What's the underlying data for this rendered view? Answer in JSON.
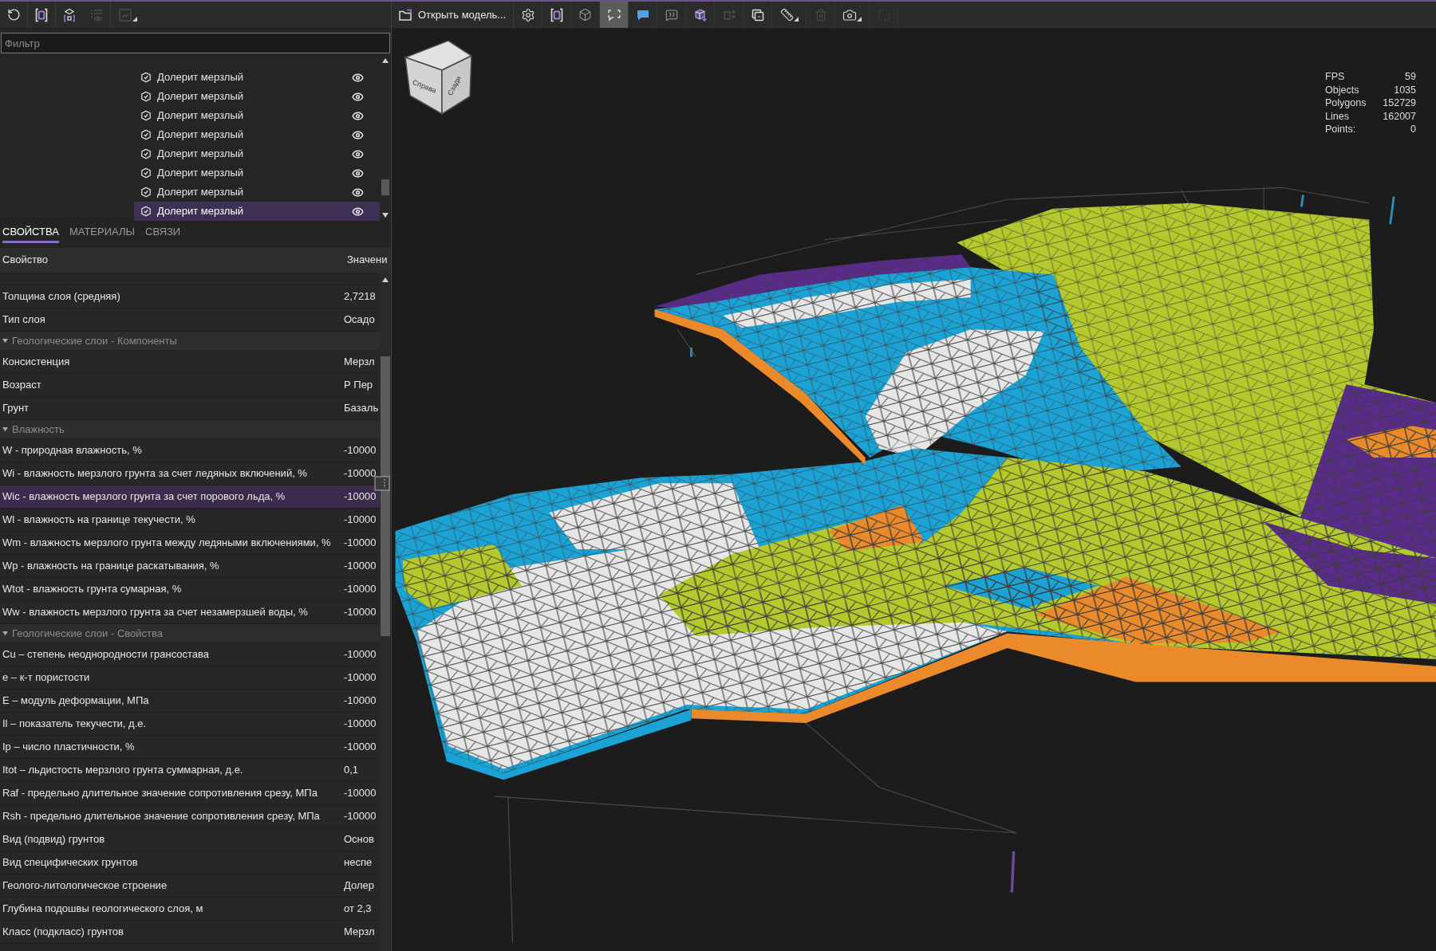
{
  "left_toolbar": {
    "buttons": [
      {
        "disabled": false,
        "dropdown": false
      },
      {
        "disabled": false,
        "dropdown": false
      },
      {
        "disabled": false,
        "dropdown": false
      },
      {
        "disabled": true,
        "dropdown": false
      },
      {
        "disabled": true,
        "dropdown": true
      }
    ]
  },
  "filter": {
    "placeholder": "Фильтр"
  },
  "tree": {
    "items": [
      {
        "label": "Долерит мерзлый",
        "visible": true,
        "selected": false
      },
      {
        "label": "Долерит мерзлый",
        "visible": true,
        "selected": false
      },
      {
        "label": "Долерит мерзлый",
        "visible": true,
        "selected": false
      },
      {
        "label": "Долерит мерзлый",
        "visible": true,
        "selected": false
      },
      {
        "label": "Долерит мерзлый",
        "visible": true,
        "selected": false
      },
      {
        "label": "Долерит мерзлый",
        "visible": true,
        "selected": false
      },
      {
        "label": "Долерит мерзлый",
        "visible": true,
        "selected": false
      },
      {
        "label": "Долерит мерзлый",
        "visible": true,
        "selected": true
      }
    ]
  },
  "properties": {
    "tabs": [
      {
        "label": "СВОЙСТВА",
        "selected": true
      },
      {
        "label": "МАТЕРИАЛЫ",
        "selected": false
      },
      {
        "label": "СВЯЗИ",
        "selected": false
      }
    ],
    "columns": [
      "Свойство",
      "Значени"
    ],
    "rows": [
      {
        "kind": "property",
        "name": "Толщина слоя (средняя)",
        "value": "2,7218",
        "selected": false
      },
      {
        "kind": "property",
        "name": "Тип слоя",
        "value": "Осадо",
        "selected": false
      },
      {
        "kind": "group",
        "label": "Геологические слои - Компоненты",
        "expanded": true
      },
      {
        "kind": "property",
        "name": "Консистенция",
        "value": "Мерзл",
        "selected": false
      },
      {
        "kind": "property",
        "name": "Возраст",
        "value": "Р Пер",
        "selected": false
      },
      {
        "kind": "property",
        "name": "Грунт",
        "value": "Базаль",
        "selected": false
      },
      {
        "kind": "group",
        "label": "Влажность",
        "expanded": true
      },
      {
        "kind": "property",
        "name": "W - природная влажность, %",
        "value": "-10000",
        "selected": false
      },
      {
        "kind": "property",
        "name": "Wi - влажность мерзлого грунта за счет ледяных включений, %",
        "value": "-10000",
        "selected": false
      },
      {
        "kind": "property",
        "name": "Wic - влажность мерзлого грунта за счет порового льда, %",
        "value": "-10000",
        "selected": true
      },
      {
        "kind": "property",
        "name": "Wl - влажность на границе текучести, %",
        "value": "-10000",
        "selected": false
      },
      {
        "kind": "property",
        "name": "Wm - влажность мерзлого грунта между ледяными включениями, %",
        "value": "-10000",
        "selected": false
      },
      {
        "kind": "property",
        "name": "Wp - влажность на границе раскатывания, %",
        "value": "-10000",
        "selected": false
      },
      {
        "kind": "property",
        "name": "Wtot - влажность грунта сумарная, %",
        "value": "-10000",
        "selected": false
      },
      {
        "kind": "property",
        "name": "Ww - влажность мерзлого грунта за счет незамерзшей воды, %",
        "value": "-10000",
        "selected": false
      },
      {
        "kind": "group",
        "label": "Геологические слои - Свойства",
        "expanded": true
      },
      {
        "kind": "property",
        "name": "Cu – степень неоднородности грансостава",
        "value": "-10000",
        "selected": false
      },
      {
        "kind": "property",
        "name": "e – к-т пористости",
        "value": "-10000",
        "selected": false
      },
      {
        "kind": "property",
        "name": "E – модуль деформации, МПа",
        "value": "-10000",
        "selected": false
      },
      {
        "kind": "property",
        "name": "Il – показатель текучести, д.е.",
        "value": "-10000",
        "selected": false
      },
      {
        "kind": "property",
        "name": "Ip – число пластичности, %",
        "value": "-10000",
        "selected": false
      },
      {
        "kind": "property",
        "name": "Itot – льдистость мерзлого грунта суммарная, д.е.",
        "value": "0,1",
        "selected": false
      },
      {
        "kind": "property",
        "name": "Raf - предельно длительное значение сопротивления срезу, МПа",
        "value": "-10000",
        "selected": false
      },
      {
        "kind": "property",
        "name": "Rsh - предельно длительное значение сопротивления срезу, МПа",
        "value": "-10000",
        "selected": false
      },
      {
        "kind": "property",
        "name": "Вид (подвид) грунтов",
        "value": "Основ",
        "selected": false
      },
      {
        "kind": "property",
        "name": "Вид специфических грунтов",
        "value": "неспе",
        "selected": false
      },
      {
        "kind": "property",
        "name": "Геолого-литологическое строение",
        "value": "Долер",
        "selected": false
      },
      {
        "kind": "property",
        "name": "Глубина подошвы геологического слоя, м",
        "value": "от 2,3",
        "selected": false
      },
      {
        "kind": "property",
        "name": "Класс (подкласс) грунтов",
        "value": "Мерзл",
        "selected": false
      }
    ]
  },
  "viewport_toolbar": {
    "open_button": {
      "label": "Открыть модель..."
    },
    "tools": [
      {
        "disabled": false,
        "selected": false,
        "dropdown": false
      },
      {
        "disabled": false,
        "selected": false,
        "dropdown": false
      },
      {
        "disabled": false,
        "selected": false,
        "dropdown": false
      },
      {
        "disabled": false,
        "selected": true,
        "dropdown": false
      },
      {
        "disabled": false,
        "selected": false,
        "dropdown": false
      },
      {
        "disabled": false,
        "selected": false,
        "dropdown": false
      },
      {
        "disabled": false,
        "selected": false,
        "dropdown": false
      },
      {
        "disabled": true,
        "selected": false,
        "dropdown": false
      },
      {
        "disabled": false,
        "selected": false,
        "dropdown": false
      },
      {
        "disabled": false,
        "selected": false,
        "dropdown": true
      },
      {
        "disabled": true,
        "selected": false,
        "dropdown": false
      },
      {
        "disabled": false,
        "selected": false,
        "dropdown": true
      },
      {
        "disabled": true,
        "selected": false,
        "dropdown": false
      }
    ]
  },
  "view_cube": {
    "faces": [
      "Справа",
      "Сзади"
    ]
  },
  "stats": [
    {
      "label": "FPS",
      "value": "59"
    },
    {
      "label": "Objects",
      "value": "1035"
    },
    {
      "label": "Polygons",
      "value": "152729"
    },
    {
      "label": "Lines",
      "value": "162007"
    },
    {
      "label": "Points:",
      "value": "0"
    }
  ]
}
